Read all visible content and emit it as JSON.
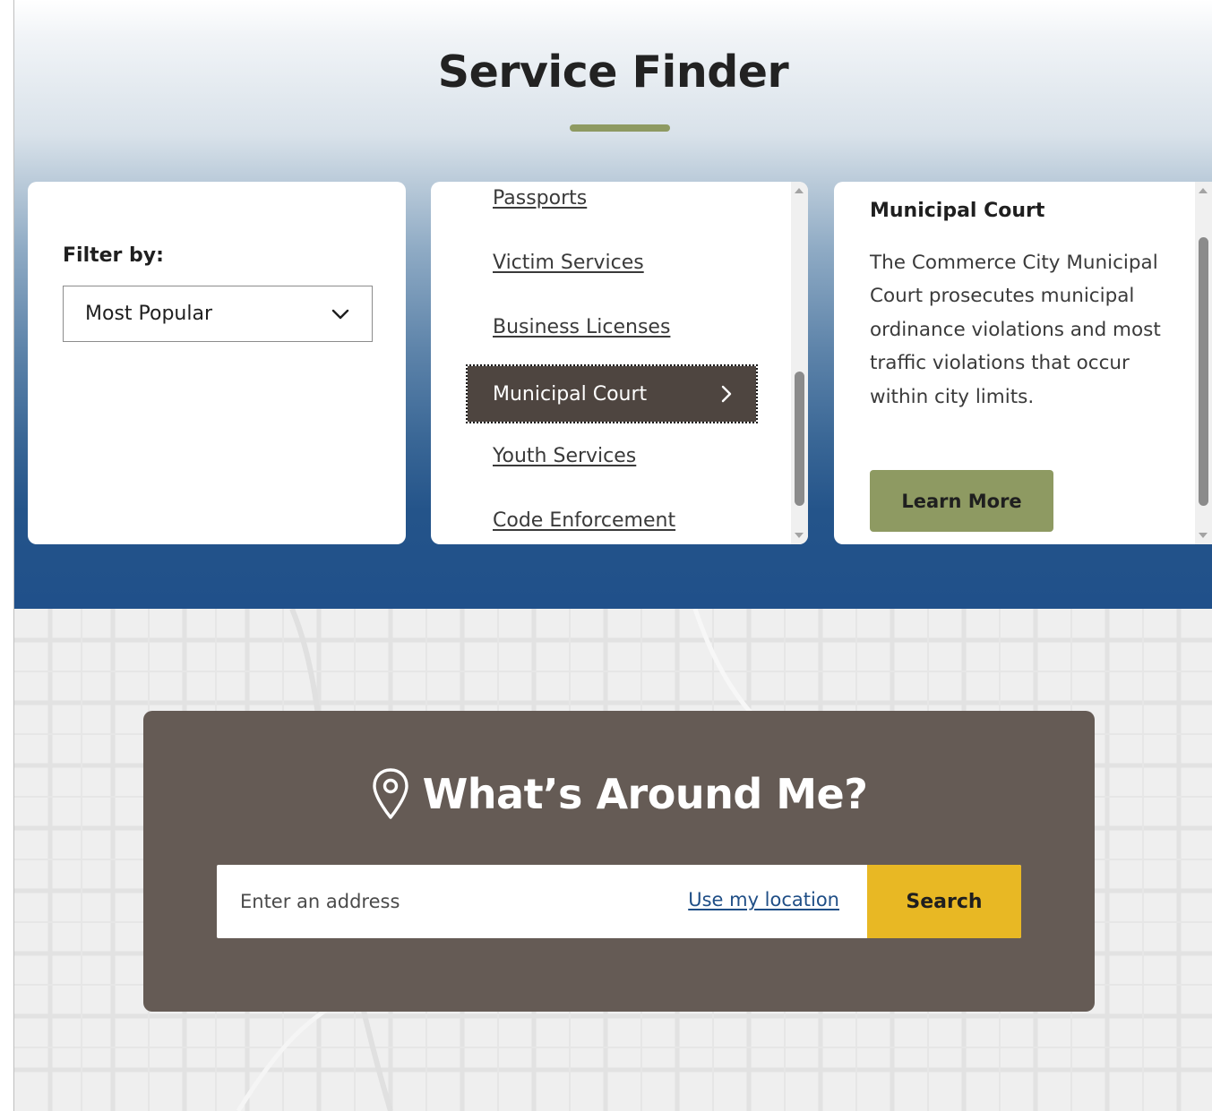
{
  "header": {
    "title": "Service Finder",
    "accent_color": "#8e9a62"
  },
  "filter": {
    "label": "Filter by:",
    "selected": "Most Popular"
  },
  "services": {
    "items": [
      {
        "label": "Passports",
        "active": false
      },
      {
        "label": "Victim Services",
        "active": false
      },
      {
        "label": "Business Licenses",
        "active": false
      },
      {
        "label": "Municipal Court",
        "active": true
      },
      {
        "label": "Youth Services",
        "active": false
      },
      {
        "label": "Code Enforcement",
        "active": false
      }
    ],
    "active_color": "#4e4540"
  },
  "detail": {
    "title": "Municipal Court",
    "description": "The Commerce City Municipal Court prosecutes municipal ordinance violations and most traffic violations that occur within city limits.",
    "button_label": "Learn More",
    "button_color": "#8e9a62"
  },
  "around_me": {
    "title": "What’s Around Me?",
    "icon": "location-pin-icon",
    "address_placeholder": "Enter an address",
    "use_location_label": "Use my location",
    "search_label": "Search",
    "search_color": "#e8b824",
    "card_color": "#655b55"
  }
}
